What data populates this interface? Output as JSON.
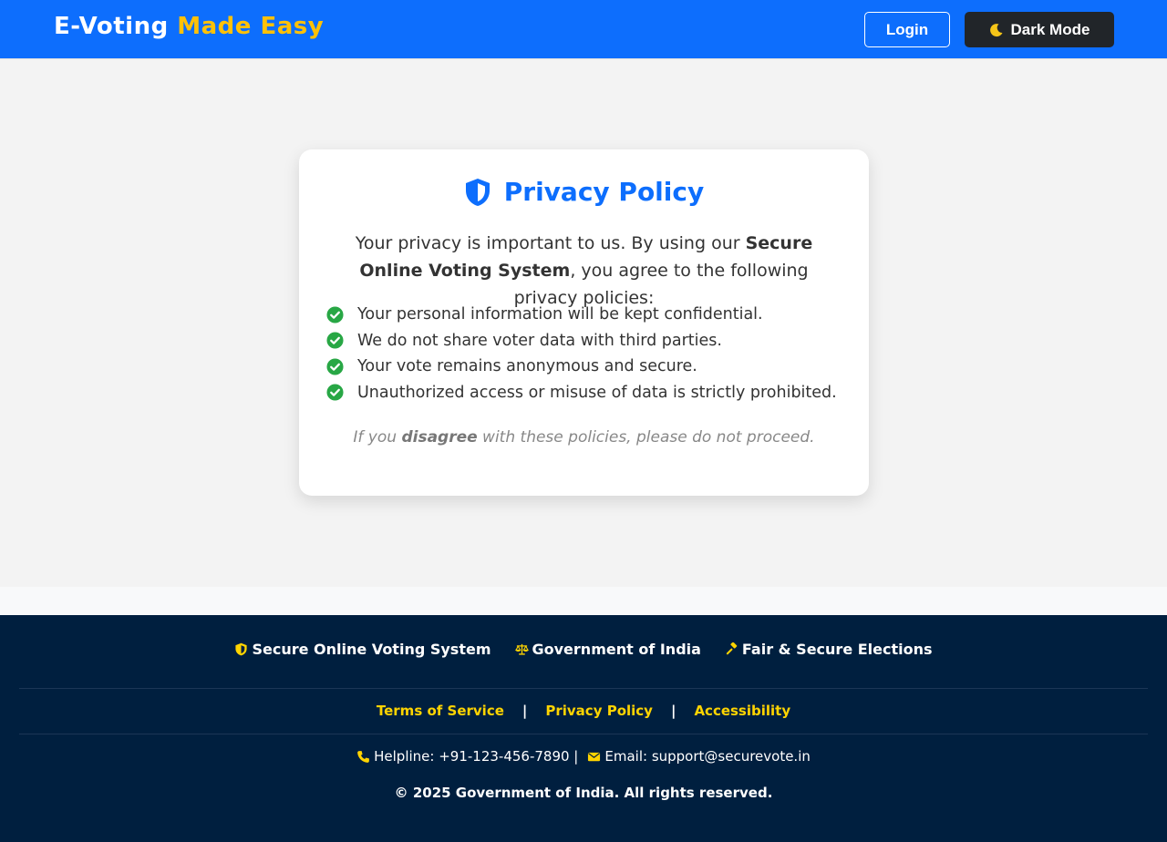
{
  "header": {
    "brand_main": "E-Voting",
    "brand_accent": "Made Easy",
    "login_label": "Login",
    "dark_mode_label": "Dark Mode",
    "dark_mode_icon": "moon-icon"
  },
  "card": {
    "title": "Privacy Policy",
    "title_icon": "shield-icon",
    "intro_before": "Your privacy is important to us. By using our ",
    "intro_bold": "Secure Online Voting System",
    "intro_after": ", you agree to the following privacy policies:",
    "items": [
      "Your personal information will be kept confidential.",
      "We do not share voter data with third parties.",
      "Your vote remains anonymous and secure.",
      "Unauthorized access or misuse of data is strictly prohibited."
    ],
    "note_before": "If you ",
    "note_bold": "disagree",
    "note_after": " with these policies, please do not proceed."
  },
  "footer": {
    "badges": [
      {
        "icon": "shield-icon",
        "label": "Secure Online Voting System"
      },
      {
        "icon": "balance-scale-icon",
        "label": "Government of India"
      },
      {
        "icon": "gavel-icon",
        "label": "Fair & Secure Elections"
      }
    ],
    "links": [
      "Terms of Service",
      "Privacy Policy",
      "Accessibility"
    ],
    "separator": "|",
    "helpline": "Helpline: +91-123-456-7890 |",
    "email": "Email: support@securevote.in",
    "copyright": "© 2025 Government of India. All rights reserved."
  },
  "colors": {
    "primary": "#0d6efd",
    "accent": "#ffc107",
    "footer_bg": "#001f3f",
    "footer_link": "#ffd400",
    "check": "#28a745"
  }
}
